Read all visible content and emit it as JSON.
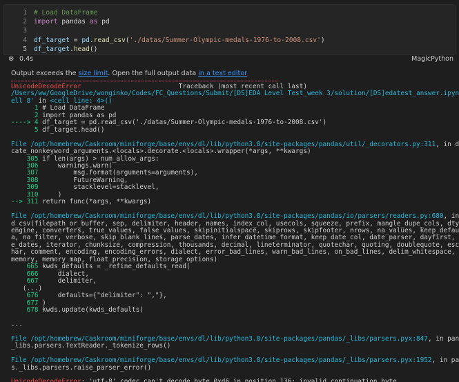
{
  "cell": {
    "lines": [
      {
        "num": "1",
        "parts": [
          {
            "c": "tok-com",
            "t": "# Load DataFrame"
          }
        ]
      },
      {
        "num": "2",
        "parts": [
          {
            "c": "tok-kw",
            "t": "import"
          },
          {
            "c": "tok-txt",
            "t": " pandas "
          },
          {
            "c": "tok-kw",
            "t": "as"
          },
          {
            "c": "tok-txt",
            "t": " pd"
          }
        ]
      },
      {
        "num": "3",
        "parts": []
      },
      {
        "num": "4",
        "parts": [
          {
            "c": "tok-var",
            "t": "df_target"
          },
          {
            "c": "tok-txt",
            "t": " = "
          },
          {
            "c": "tok-var",
            "t": "pd"
          },
          {
            "c": "tok-txt",
            "t": "."
          },
          {
            "c": "tok-fn",
            "t": "read_csv"
          },
          {
            "c": "tok-txt",
            "t": "("
          },
          {
            "c": "tok-str",
            "t": "'./datas/Summer-Olympic-medals-1976-to-2008.csv'"
          },
          {
            "c": "tok-txt",
            "t": ")"
          }
        ]
      },
      {
        "num": "5",
        "parts": [
          {
            "c": "tok-var",
            "t": "df_target"
          },
          {
            "c": "tok-txt",
            "t": "."
          },
          {
            "c": "tok-fn",
            "t": "head"
          },
          {
            "c": "tok-txt",
            "t": "()"
          }
        ]
      }
    ]
  },
  "status": {
    "close_glyph": "⊗",
    "exec_time": "0.4s",
    "language": "MagicPython"
  },
  "notice": {
    "prefix": "Output exceeds the ",
    "link1": "size limit",
    "middle": ". Open the full output data ",
    "link2": "in a text editor"
  },
  "output_lines": [
    [
      {
        "c": "red",
        "t": "UnicodeDecodeError"
      },
      {
        "c": "dim",
        "t": "                         Traceback (most recent call last)"
      }
    ],
    [
      {
        "c": "cyan",
        "t": "/Users/ww/GoogleDrive/wonginko/Codes/FC_Questions/Submit/[DS]EDA Level Test_week 3/solution/[DS]edatest_answer.ipynb C"
      }
    ],
    [
      {
        "c": "cyan",
        "t": "ell 8'"
      },
      {
        "c": "dim",
        "t": " in "
      },
      {
        "c": "cyan",
        "t": "<cell line: 4>()"
      }
    ],
    [
      {
        "c": "green",
        "t": "      1"
      },
      {
        "c": "dim",
        "t": " # Load DataFrame"
      }
    ],
    [
      {
        "c": "green",
        "t": "      2"
      },
      {
        "c": "dim",
        "t": " import pandas as pd"
      }
    ],
    [
      {
        "c": "green",
        "t": "----> 4"
      },
      {
        "c": "dim",
        "t": " df_target = pd.read_csv('./datas/Summer-Olympic-medals-1976-to-2008.csv')"
      }
    ],
    [
      {
        "c": "green",
        "t": "      5"
      },
      {
        "c": "dim",
        "t": " df_target.head()"
      }
    ],
    [],
    [
      {
        "c": "cyan",
        "t": "File /opt/homebrew/Caskroom/miniforge/base/envs/dl/lib/python3.8/site-packages/pandas/util/_decorators.py:311"
      },
      {
        "c": "dim",
        "t": ", in depre"
      }
    ],
    [
      {
        "c": "dim",
        "t": "cate_nonkeyword_arguments.<locals>.decorate.<locals>.wrapper(*args, **kwargs)"
      }
    ],
    [
      {
        "c": "green",
        "t": "    305"
      },
      {
        "c": "dim",
        "t": " if len(args) > num_allow_args:"
      }
    ],
    [
      {
        "c": "green",
        "t": "    306"
      },
      {
        "c": "dim",
        "t": "     warnings.warn("
      }
    ],
    [
      {
        "c": "green",
        "t": "    307"
      },
      {
        "c": "dim",
        "t": "         msg.format(arguments=arguments),"
      }
    ],
    [
      {
        "c": "green",
        "t": "    308"
      },
      {
        "c": "dim",
        "t": "         FutureWarning,"
      }
    ],
    [
      {
        "c": "green",
        "t": "    309"
      },
      {
        "c": "dim",
        "t": "         stacklevel=stacklevel,"
      }
    ],
    [
      {
        "c": "green",
        "t": "    310"
      },
      {
        "c": "dim",
        "t": "     )"
      }
    ],
    [
      {
        "c": "green",
        "t": "--> 311"
      },
      {
        "c": "dim",
        "t": " return func(*args, **kwargs)"
      }
    ],
    [],
    [
      {
        "c": "cyan",
        "t": "File /opt/homebrew/Caskroom/miniforge/base/envs/dl/lib/python3.8/site-packages/pandas/io/parsers/readers.py:680"
      },
      {
        "c": "dim",
        "t": ", in rea"
      }
    ],
    [
      {
        "c": "dim",
        "t": "d_csv(filepath_or_buffer, sep, delimiter, header, names, index_col, usecols, squeeze, prefix, mangle_dupe_cols, dtype,"
      }
    ],
    [
      {
        "c": "dim",
        "t": "engine, converters, true_values, false_values, skipinitialspace, skiprows, skipfooter, nrows, na_values, keep_default_n"
      }
    ],
    [
      {
        "c": "dim",
        "t": "a, na_filter, verbose, skip_blank_lines, parse_dates, infer_datetime_format, keep_date_col, date_parser, dayfirst, cach"
      }
    ],
    [
      {
        "c": "dim",
        "t": "e_dates, iterator, chunksize, compression, thousands, decimal, lineterminator, quotechar, quoting, doublequote, escapec"
      }
    ],
    [
      {
        "c": "dim",
        "t": "har, comment, encoding, encoding_errors, dialect, error_bad_lines, warn_bad_lines, on_bad_lines, delim_whitespace, low_"
      }
    ],
    [
      {
        "c": "dim",
        "t": "memory, memory_map, float_precision, storage_options)"
      }
    ],
    [
      {
        "c": "green",
        "t": "    665"
      },
      {
        "c": "dim",
        "t": " kwds_defaults = _refine_defaults_read("
      }
    ],
    [
      {
        "c": "green",
        "t": "    666"
      },
      {
        "c": "dim",
        "t": "     dialect,"
      }
    ],
    [
      {
        "c": "green",
        "t": "    667"
      },
      {
        "c": "dim",
        "t": "     delimiter,"
      }
    ],
    [
      {
        "c": "dim",
        "t": "   (...)"
      }
    ],
    [
      {
        "c": "green",
        "t": "    676"
      },
      {
        "c": "dim",
        "t": "     defaults={\"delimiter\": \",\"},"
      }
    ],
    [
      {
        "c": "green",
        "t": "    677"
      },
      {
        "c": "dim",
        "t": " )"
      }
    ],
    [
      {
        "c": "green",
        "t": "    678"
      },
      {
        "c": "dim",
        "t": " kwds.update(kwds_defaults)"
      }
    ],
    [],
    [
      {
        "c": "dim",
        "t": "..."
      }
    ],
    [],
    [
      {
        "c": "cyan",
        "t": "File /opt/homebrew/Caskroom/miniforge/base/envs/dl/lib/python3.8/site-packages/pandas/_libs/parsers.pyx:847"
      },
      {
        "c": "dim",
        "t": ", in pandas."
      }
    ],
    [
      {
        "c": "dim",
        "t": "_libs.parsers.TextReader._tokenize_rows()"
      }
    ],
    [],
    [
      {
        "c": "cyan",
        "t": "File /opt/homebrew/Caskroom/miniforge/base/envs/dl/lib/python3.8/site-packages/pandas/_libs/parsers.pyx:1952"
      },
      {
        "c": "dim",
        "t": ", in panda"
      }
    ],
    [
      {
        "c": "dim",
        "t": "s._libs.parsers.raise_parser_error()"
      }
    ],
    [],
    [
      {
        "c": "red",
        "t": "UnicodeDecodeError"
      },
      {
        "c": "dim",
        "t": ": 'utf-8' codec can't decode byte 0xd6 in position 136: invalid continuation byte"
      }
    ]
  ]
}
